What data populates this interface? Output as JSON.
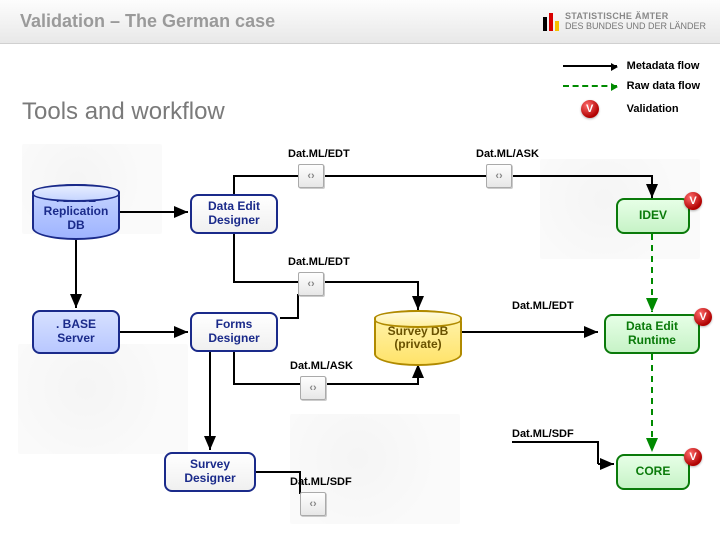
{
  "header": {
    "title": "Validation – The German case",
    "logo_line1": "STATISTISCHE ÄMTER",
    "logo_line2": "DES BUNDES UND DER LÄNDER"
  },
  "subtitle": "Tools and workflow",
  "legend": {
    "metadata": "Metadata flow",
    "rawdata": "Raw data flow",
    "validation_symbol": "V",
    "validation": "Validation"
  },
  "nodes": {
    "base_repl_db": ". BASE\nReplication\nDB",
    "base_server": ". BASE\nServer",
    "data_edit_designer": "Data Edit\nDesigner",
    "forms_designer": "Forms\nDesigner",
    "survey_designer": "Survey\nDesigner",
    "survey_db": "Survey DB\n(private)",
    "idev": "IDEV",
    "data_edit_runtime": "Data Edit\nRuntime",
    "core": "CORE"
  },
  "files": {
    "datml_edt": "Dat.ML/EDT",
    "datml_ask": "Dat.ML/ASK",
    "datml_sdf": "Dat.ML/SDF"
  }
}
